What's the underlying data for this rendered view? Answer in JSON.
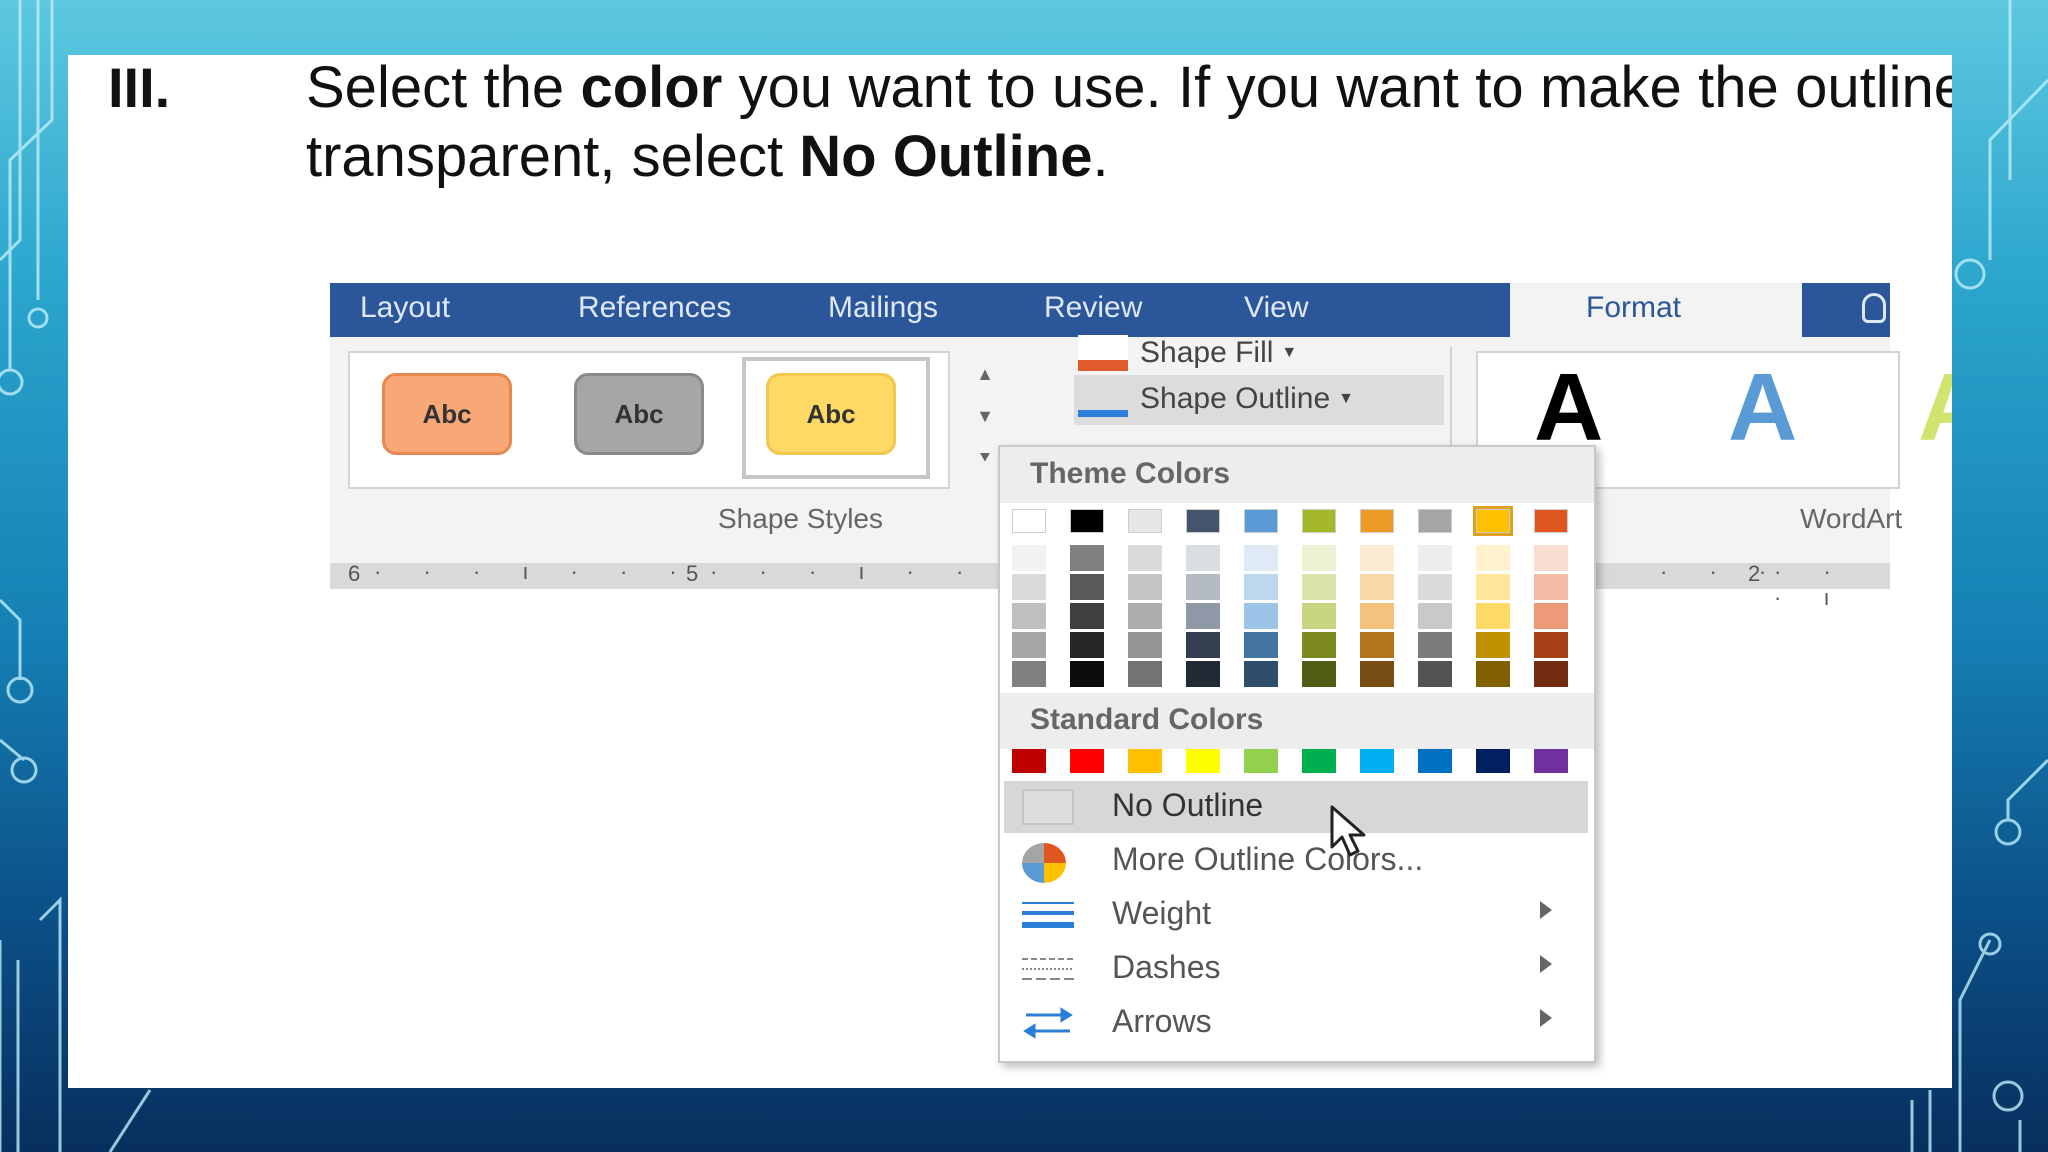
{
  "instruction": {
    "numeral": "III.",
    "part1": "Select the ",
    "bold1": "color",
    "part2": " you want to use. If you want to make the outline transparent, select ",
    "bold2": "No Outline",
    "part3": "."
  },
  "ribbon": {
    "tabs": [
      "Layout",
      "References",
      "Mailings",
      "Review",
      "View"
    ],
    "active_tab": "Format",
    "tell_me_icon": "lightbulb-icon",
    "shape_styles": {
      "buttons": [
        "Abc",
        "Abc",
        "Abc"
      ],
      "group_label": "Shape Styles"
    },
    "shape_fill_label": "Shape Fill",
    "shape_outline_label": "Shape Outline",
    "wordart": {
      "samples": [
        "A",
        "A",
        "A"
      ],
      "group_label": "WordArt"
    },
    "ruler": {
      "left_label_1": "6",
      "left_label_2": "5",
      "right_label": "2"
    }
  },
  "outline_menu": {
    "theme_colors_header": "Theme Colors",
    "theme_colors": [
      "#ffffff",
      "#000000",
      "#e7e6e6",
      "#44546a",
      "#5b9bd5",
      "#a5b82a",
      "#ed9a27",
      "#a5a5a5",
      "#ffc000",
      "#e0561f"
    ],
    "standard_colors_header": "Standard Colors",
    "standard_colors": [
      "#c00000",
      "#ff0000",
      "#ffc000",
      "#ffff00",
      "#92d050",
      "#00b050",
      "#00b0f0",
      "#0070c0",
      "#002060",
      "#7030a0"
    ],
    "items": [
      {
        "label": "No Outline",
        "icon": "empty-swatch-icon",
        "has_submenu": false
      },
      {
        "label": "More Outline Colors...",
        "icon": "color-wheel-icon",
        "has_submenu": false
      },
      {
        "label": "Weight",
        "icon": "line-weight-icon",
        "has_submenu": true
      },
      {
        "label": "Dashes",
        "icon": "dashes-icon",
        "has_submenu": true
      },
      {
        "label": "Arrows",
        "icon": "arrows-icon",
        "has_submenu": true
      }
    ]
  }
}
